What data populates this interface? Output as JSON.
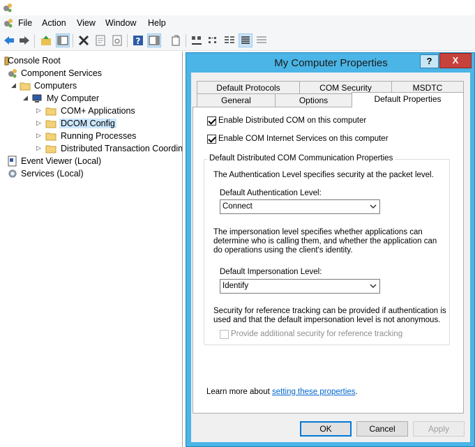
{
  "menu": {
    "items": [
      "File",
      "Action",
      "View",
      "Window",
      "Help"
    ]
  },
  "toolbar": {
    "buttons": [
      "back-icon",
      "forward-icon",
      "up-folder-icon",
      "show-hide-tree-icon",
      "delete-icon",
      "properties-icon",
      "refresh-icon",
      "help-icon",
      "action-pane-icon",
      "export-icon",
      "large-icons-icon",
      "small-icons-icon",
      "list-icon",
      "details-icon",
      "columns-icon"
    ]
  },
  "tree": {
    "root": "Console Root",
    "component_services": "Component Services",
    "computers": "Computers",
    "my_computer": "My Computer",
    "com_plus": "COM+ Applications",
    "dcom_config": "DCOM Config",
    "running_processes": "Running Processes",
    "dtc": "Distributed Transaction Coordinator",
    "event_viewer": "Event Viewer (Local)",
    "services": "Services (Local)"
  },
  "dialog": {
    "title": "My Computer Properties",
    "help": "?",
    "close": "X",
    "tabs_row1": [
      "Default Protocols",
      "COM Security",
      "MSDTC"
    ],
    "tabs_row2": [
      "General",
      "Options",
      "Default Properties"
    ],
    "selected_tab": "Default Properties",
    "enable_dcom": "Enable Distributed COM on this computer",
    "enable_cis": "Enable COM Internet Services on this computer",
    "group_title": "Default Distributed COM Communication Properties",
    "auth_desc": "The Authentication Level specifies security at the packet level.",
    "auth_label": "Default Authentication Level:",
    "auth_value": "Connect",
    "imp_desc": "The impersonation level specifies whether applications can determine who is calling them, and whether the application can do operations using the client's identity.",
    "imp_label": "Default Impersonation Level:",
    "imp_value": "Identify",
    "ref_desc": "Security for reference tracking can be provided if authentication is used and that the default impersonation level is not anonymous.",
    "ref_check": "Provide additional security for reference tracking",
    "learn_prefix": "Learn more about ",
    "learn_link": "setting these properties",
    "learn_suffix": ".",
    "ok": "OK",
    "cancel": "Cancel",
    "apply": "Apply"
  }
}
